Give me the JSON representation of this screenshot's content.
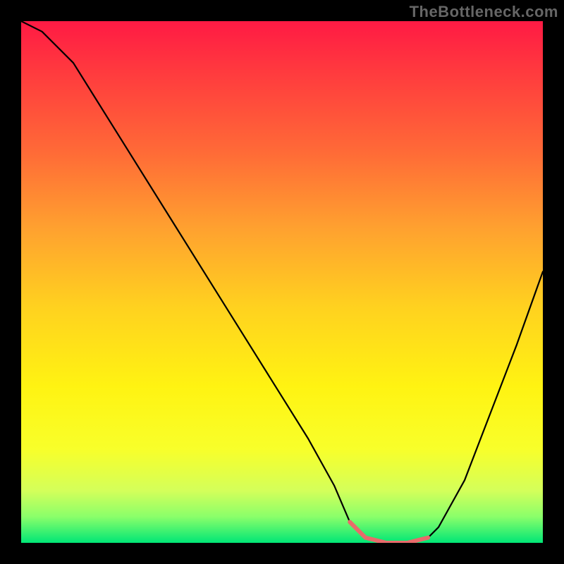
{
  "watermark": "TheBottleneck.com",
  "chart_data": {
    "type": "line",
    "title": "",
    "xlabel": "",
    "ylabel": "",
    "xlim": [
      0,
      100
    ],
    "ylim": [
      0,
      100
    ],
    "grid": false,
    "legend": false,
    "gradient_stops": [
      {
        "offset": 0.0,
        "color": "#ff1a44"
      },
      {
        "offset": 0.1,
        "color": "#ff3b3e"
      },
      {
        "offset": 0.25,
        "color": "#ff6a37"
      },
      {
        "offset": 0.4,
        "color": "#ffa22f"
      },
      {
        "offset": 0.55,
        "color": "#ffd21f"
      },
      {
        "offset": 0.7,
        "color": "#fff312"
      },
      {
        "offset": 0.82,
        "color": "#f8ff2a"
      },
      {
        "offset": 0.9,
        "color": "#d4ff5a"
      },
      {
        "offset": 0.95,
        "color": "#8aff6a"
      },
      {
        "offset": 1.0,
        "color": "#00e676"
      }
    ],
    "series": [
      {
        "name": "curve",
        "stroke": "#000000",
        "stroke_width": 2.2,
        "x": [
          0,
          4,
          10,
          20,
          30,
          40,
          50,
          55,
          60,
          63,
          66,
          70,
          74,
          78,
          80,
          85,
          90,
          95,
          100
        ],
        "y": [
          100,
          98,
          92,
          76,
          60,
          44,
          28,
          20,
          11,
          4,
          1,
          0,
          0,
          1,
          3,
          12,
          25,
          38,
          52
        ]
      },
      {
        "name": "optimal-band",
        "stroke": "#e86b6b",
        "stroke_width": 6,
        "x": [
          63,
          66,
          70,
          74,
          78
        ],
        "y": [
          4,
          1,
          0,
          0,
          1
        ]
      }
    ]
  }
}
